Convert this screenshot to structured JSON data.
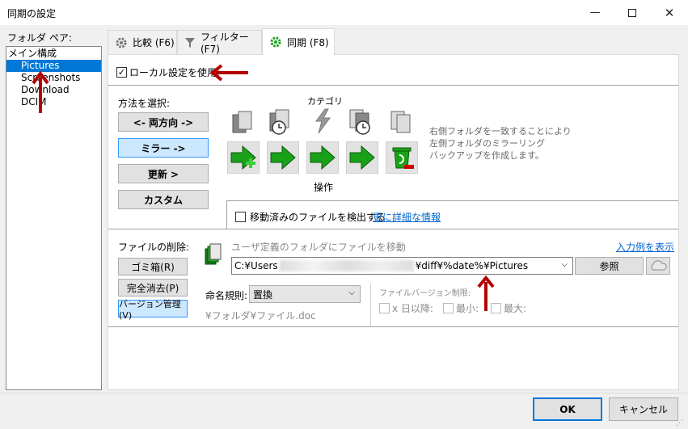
{
  "window": {
    "title": "同期の設定"
  },
  "left": {
    "pairs_label": "フォルダ ペア:",
    "items": [
      {
        "label": "メイン構成",
        "selected": false
      },
      {
        "label": "Pictures",
        "selected": true
      },
      {
        "label": "Screenshots",
        "selected": false
      },
      {
        "label": "Download",
        "selected": false
      },
      {
        "label": "DCIM",
        "selected": false
      }
    ]
  },
  "tabs": [
    {
      "label": "比較 (F6)",
      "icon": "gear-icon",
      "active": false
    },
    {
      "label": "フィルター (F7)",
      "icon": "filter-icon",
      "active": false
    },
    {
      "label": "同期 (F8)",
      "icon": "gear-icon",
      "active": true
    }
  ],
  "sync": {
    "use_local_label": "ローカル設定を使用:",
    "use_local_checked": true,
    "method_label": "方法を選択:",
    "methods": [
      {
        "label": "<- 両方向 ->",
        "selected": false
      },
      {
        "label": "ミラー ->",
        "selected": true
      },
      {
        "label": "更新 >",
        "selected": false
      },
      {
        "label": "カスタム",
        "selected": false
      }
    ],
    "category_label": "カテゴリ",
    "action_label": "操作",
    "description": [
      "右側フォルダを一致することにより",
      "左側フォルダのミラーリング",
      "バックアップを作成します。"
    ],
    "detect_moved_label": "移動済みのファイルを検出する",
    "detect_moved_checked": false,
    "more_info_link": "更に詳細な情報"
  },
  "deletion": {
    "label": "ファイルの削除:",
    "buttons": [
      {
        "label": "ゴミ箱(R)",
        "selected": false
      },
      {
        "label": "完全消去(P)",
        "selected": false
      },
      {
        "label": "バージョン管理(V)",
        "selected": true
      }
    ],
    "custom_folder_label": "ユーザ定義のフォルダにファイルを移動",
    "example_link": "入力例を表示",
    "path_prefix": "C:¥Users",
    "path_suffix": "¥diff¥%date%¥Pictures",
    "browse_label": "参照",
    "naming_label": "命名規則:",
    "naming_value": "置換",
    "naming_example": "¥フォルダ¥ファイル.doc",
    "version_limit_label": "ファイルバージョン制限:",
    "days_label": "x 日以降:",
    "min_label": "最小:",
    "max_label": "最大:"
  },
  "footer": {
    "ok_label": "OK",
    "cancel_label": "キャンセル"
  },
  "colors": {
    "accent": "#0078d7",
    "arrow": "#b30000",
    "icon_green": "#1aa11a",
    "link": "#0066cc"
  }
}
